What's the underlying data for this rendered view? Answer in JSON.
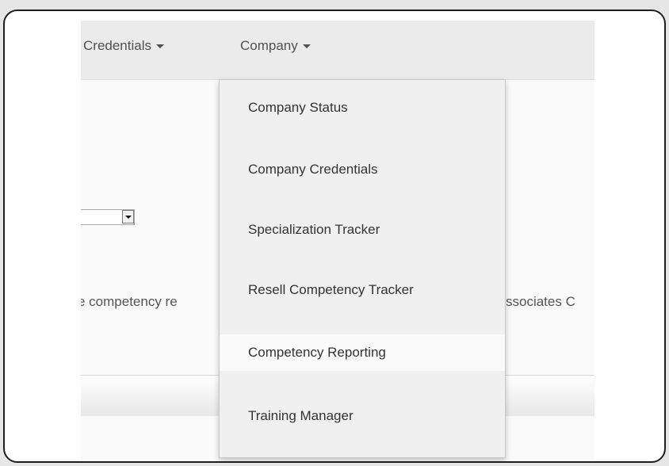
{
  "navbar": {
    "credentials_label": "Credentials",
    "company_label": "Company"
  },
  "page": {
    "body_text_left": "e competency re",
    "body_text_right": "ssociates C"
  },
  "company_menu": {
    "items": [
      {
        "label": "Company Status",
        "active": false
      },
      {
        "label": "Company Credentials",
        "active": false
      },
      {
        "label": "Specialization Tracker",
        "active": false
      },
      {
        "label": "Resell Competency Tracker",
        "active": false
      },
      {
        "label": "Competency Reporting",
        "active": true
      },
      {
        "label": "Training Manager",
        "active": false
      }
    ]
  },
  "icons": {
    "caret": "caret-down-icon",
    "select_arrow": "select-arrow-icon"
  },
  "colors": {
    "navbar_bg": "#ebebeb",
    "dropdown_bg": "#f0f0f0",
    "active_item_bg": "#fafafa",
    "text": "#333333"
  }
}
